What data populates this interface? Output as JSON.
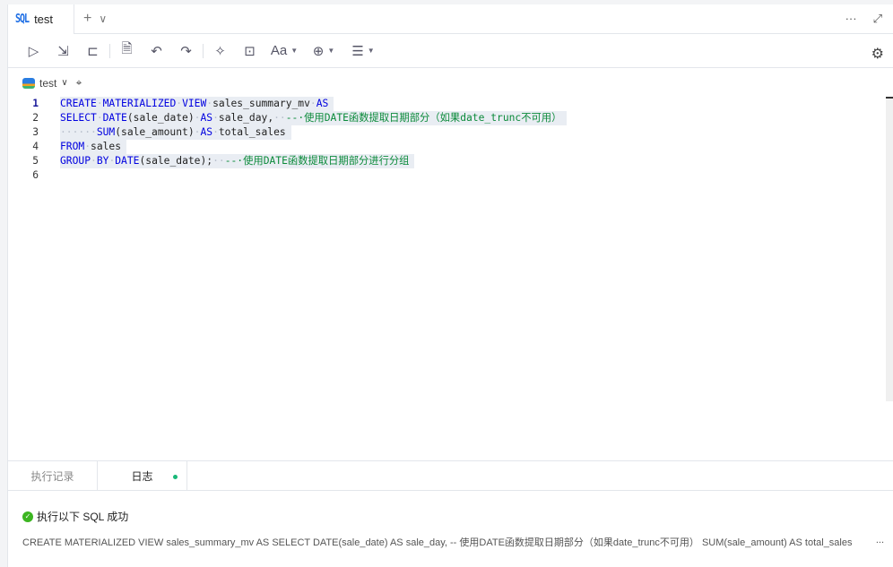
{
  "tabs": {
    "active": {
      "icon": "SQL",
      "label": "test"
    },
    "add": "+",
    "more": "∨",
    "overflow": "···",
    "fullscreen": "⤢"
  },
  "toolbar": [
    {
      "name": "run-button",
      "icon": "▷"
    },
    {
      "name": "run-selected-button",
      "icon": "⇲"
    },
    {
      "name": "explain-button",
      "icon": "⊏"
    },
    {
      "name": "sep"
    },
    {
      "name": "find-button",
      "icon": "🗎"
    },
    {
      "name": "undo-button",
      "icon": "↶"
    },
    {
      "name": "redo-button",
      "icon": "↷"
    },
    {
      "name": "sep"
    },
    {
      "name": "format-button",
      "icon": "✧"
    },
    {
      "name": "snippet-button",
      "icon": "⊡"
    },
    {
      "name": "font-button",
      "icon": "Aa",
      "caret": true
    },
    {
      "name": "comment-button",
      "icon": "⊕",
      "caret": true
    },
    {
      "name": "indent-button",
      "icon": "☰",
      "caret": true
    }
  ],
  "settings_icon": "⚙",
  "db": {
    "name": "test",
    "chevron": "∨",
    "locate": "⌖"
  },
  "code_lines": [
    [
      [
        "kw",
        "CREATE"
      ],
      [
        "ws",
        "·"
      ],
      [
        "kw",
        "MATERIALIZED"
      ],
      [
        "ws",
        "·"
      ],
      [
        "kw",
        "VIEW"
      ],
      [
        "ws",
        "·"
      ],
      [
        "id",
        "sales_summary_mv"
      ],
      [
        "ws",
        "·"
      ],
      [
        "kw",
        "AS"
      ]
    ],
    [
      [
        "kw",
        "SELECT"
      ],
      [
        "ws",
        "·"
      ],
      [
        "kw",
        "DATE"
      ],
      [
        "id",
        "(sale_date)"
      ],
      [
        "ws",
        "·"
      ],
      [
        "kw",
        "AS"
      ],
      [
        "ws",
        "·"
      ],
      [
        "id",
        "sale_day,"
      ],
      [
        "ws",
        "··"
      ],
      [
        "cm",
        "--·使用DATE函数提取日期部分（如果date_trunc不可用）"
      ]
    ],
    [
      [
        "ws",
        "······"
      ],
      [
        "kw",
        "SUM"
      ],
      [
        "id",
        "(sale_amount)"
      ],
      [
        "ws",
        "·"
      ],
      [
        "kw",
        "AS"
      ],
      [
        "ws",
        "·"
      ],
      [
        "id",
        "total_sales"
      ]
    ],
    [
      [
        "kw",
        "FROM"
      ],
      [
        "ws",
        "·"
      ],
      [
        "id",
        "sales"
      ]
    ],
    [
      [
        "kw",
        "GROUP"
      ],
      [
        "ws",
        "·"
      ],
      [
        "kw",
        "BY"
      ],
      [
        "ws",
        "·"
      ],
      [
        "kw",
        "DATE"
      ],
      [
        "id",
        "(sale_date);"
      ],
      [
        "ws",
        "··"
      ],
      [
        "cm",
        "--·使用DATE函数提取日期部分进行分组"
      ]
    ],
    []
  ],
  "bottom_tabs": [
    {
      "label": "执行记录",
      "active": false
    },
    {
      "label": "日志",
      "active": true
    }
  ],
  "log": {
    "status": "执行以下 SQL 成功",
    "text": "CREATE MATERIALIZED VIEW sales_summary_mv AS SELECT DATE(sale_date) AS sale_day, -- 使用DATE函数提取日期部分（如果date_trunc不可用） SUM(sale_amount) AS total_sales",
    "ellipsis": "..."
  },
  "colors": {
    "keyword": "#0000e0",
    "comment": "#0b8a3a",
    "success": "#3cb521",
    "accent": "#1f6fe5"
  }
}
